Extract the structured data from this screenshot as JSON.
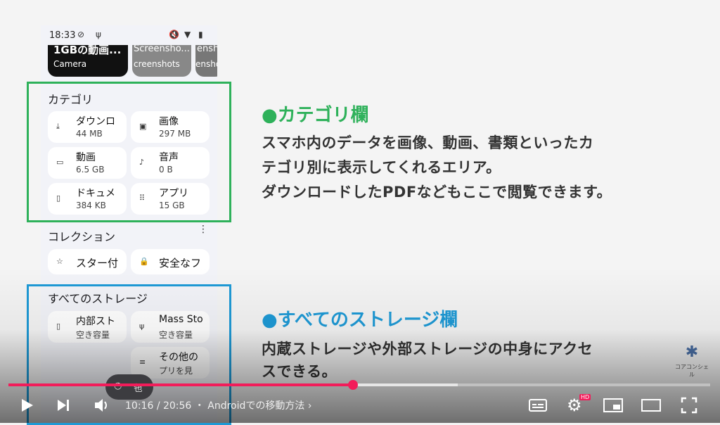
{
  "phone": {
    "status_time": "18:33",
    "thumbnails": [
      {
        "title": "1GBの動画...",
        "label": "Camera"
      },
      {
        "title": "Screensho...",
        "label": "creenshots"
      },
      {
        "title": "ensh",
        "label": "enshot"
      }
    ],
    "category_title": "カテゴリ",
    "categories": [
      {
        "icon": "download-icon",
        "label": "ダウンロ",
        "size": "44 MB"
      },
      {
        "icon": "image-icon",
        "label": "画像",
        "size": "297 MB"
      },
      {
        "icon": "video-icon",
        "label": "動画",
        "size": "6.5 GB"
      },
      {
        "icon": "music-icon",
        "label": "音声",
        "size": "0 B"
      },
      {
        "icon": "document-icon",
        "label": "ドキュメ",
        "size": "384 KB"
      },
      {
        "icon": "apps-icon",
        "label": "アプリ",
        "size": "15 GB"
      }
    ],
    "collection_title": "コレクション",
    "collections": [
      {
        "icon": "star-icon",
        "label": "スター付"
      },
      {
        "icon": "lock-icon",
        "label": "安全なフ"
      }
    ],
    "storage_title": "すべてのストレージ",
    "storages": [
      {
        "icon": "phone-icon",
        "label": "内部スト",
        "sub": "空き容量"
      },
      {
        "icon": "usb-icon",
        "label": "Mass Sto",
        "sub": "空き容量"
      },
      {
        "icon": "list-icon",
        "label": "その他の",
        "sub": "プリを見"
      }
    ]
  },
  "annotations": {
    "category_heading": "●カテゴリ欄",
    "category_line1": "スマホ内のデータを画像、動画、書類といったカ",
    "category_line2": "テゴリ別に表示してくれるエリア。",
    "category_line3": "ダウンロードしたPDFなどもここで閲覧できます。",
    "storage_heading": "●すべてのストレージ欄",
    "storage_line1": "内蔵ストレージや外部ストレージの中身にアクセ",
    "storage_line2": "スできる。"
  },
  "logo_text": "コアコンシェル",
  "player": {
    "current_time": "10:16",
    "duration": "20:56",
    "chapter": "Androidでの移動方法",
    "progress_fraction": 0.491,
    "buffered_fraction": 0.64,
    "hd_badge": "HD",
    "accent": "#f21c5a"
  },
  "colors": {
    "green": "#2eb15a",
    "blue": "#1e9ad6"
  }
}
